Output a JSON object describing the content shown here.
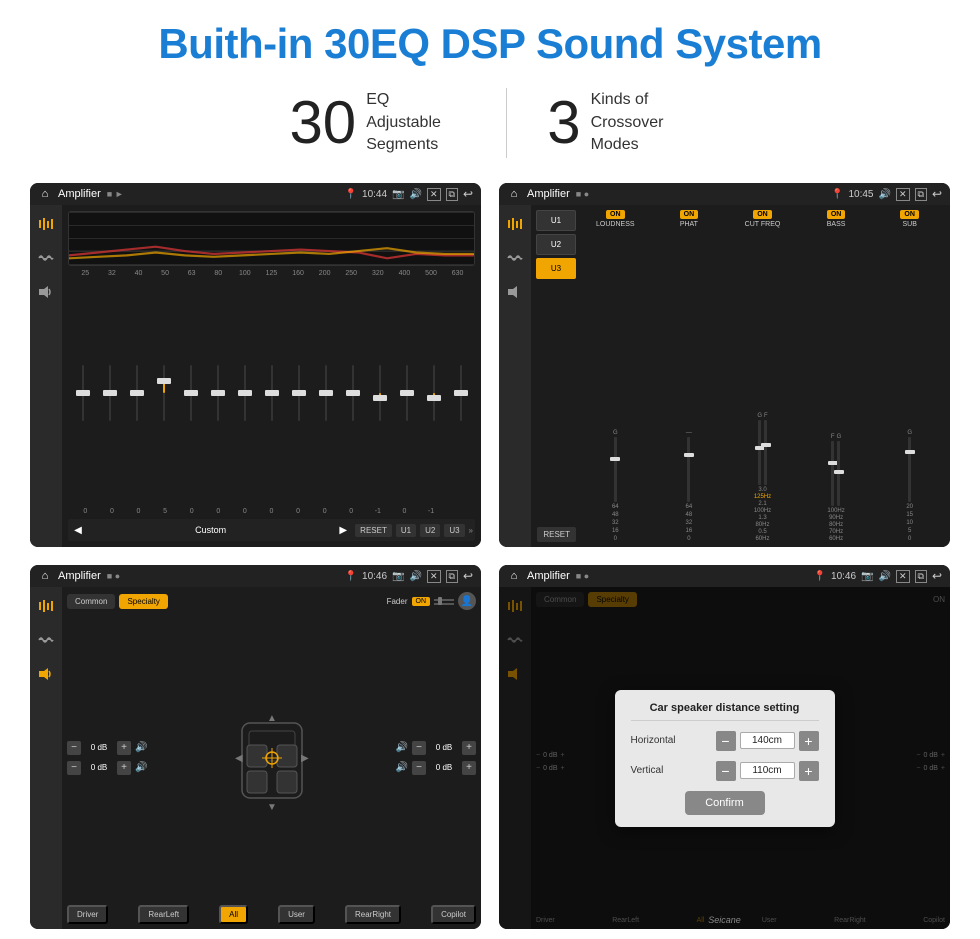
{
  "header": {
    "title": "Buith-in 30EQ DSP Sound System"
  },
  "stats": [
    {
      "number": "30",
      "desc": "EQ Adjustable\nSegments"
    },
    {
      "number": "3",
      "desc": "Kinds of\nCrossover Modes"
    }
  ],
  "screens": [
    {
      "id": "eq",
      "app_label": "Amplifier",
      "time": "10:44",
      "eq_freqs": [
        "25",
        "32",
        "40",
        "50",
        "63",
        "80",
        "100",
        "125",
        "160",
        "200",
        "250",
        "320",
        "400",
        "500",
        "630"
      ],
      "eq_values": [
        "0",
        "0",
        "0",
        "5",
        "0",
        "0",
        "0",
        "0",
        "0",
        "0",
        "0",
        "-1",
        "0",
        "-1"
      ],
      "preset": "Custom",
      "buttons": [
        "RESET",
        "U1",
        "U2",
        "U3"
      ]
    },
    {
      "id": "crossover",
      "app_label": "Amplifier",
      "time": "10:45",
      "channels": [
        "LOUDNESS",
        "PHAT",
        "CUT FREQ",
        "BASS",
        "SUB"
      ],
      "active_preset": "U3"
    },
    {
      "id": "specialty",
      "app_label": "Amplifier",
      "time": "10:46",
      "tabs": [
        "Common",
        "Specialty"
      ],
      "active_tab": "Specialty",
      "fader_label": "Fader",
      "fader_state": "ON",
      "volumes": [
        {
          "label": "0 dB",
          "side": "left"
        },
        {
          "label": "0 dB",
          "side": "left"
        },
        {
          "label": "0 dB",
          "side": "right"
        },
        {
          "label": "0 dB",
          "side": "right"
        }
      ],
      "zone_buttons": [
        "Driver",
        "RearLeft",
        "All",
        "User",
        "RearRight",
        "Copilot"
      ]
    },
    {
      "id": "dialog",
      "app_label": "Amplifier",
      "time": "10:46",
      "dialog": {
        "title": "Car speaker distance setting",
        "horizontal_label": "Horizontal",
        "horizontal_value": "140cm",
        "vertical_label": "Vertical",
        "vertical_value": "110cm",
        "confirm_label": "Confirm"
      }
    }
  ],
  "footer": {
    "brand": "Seicane"
  }
}
